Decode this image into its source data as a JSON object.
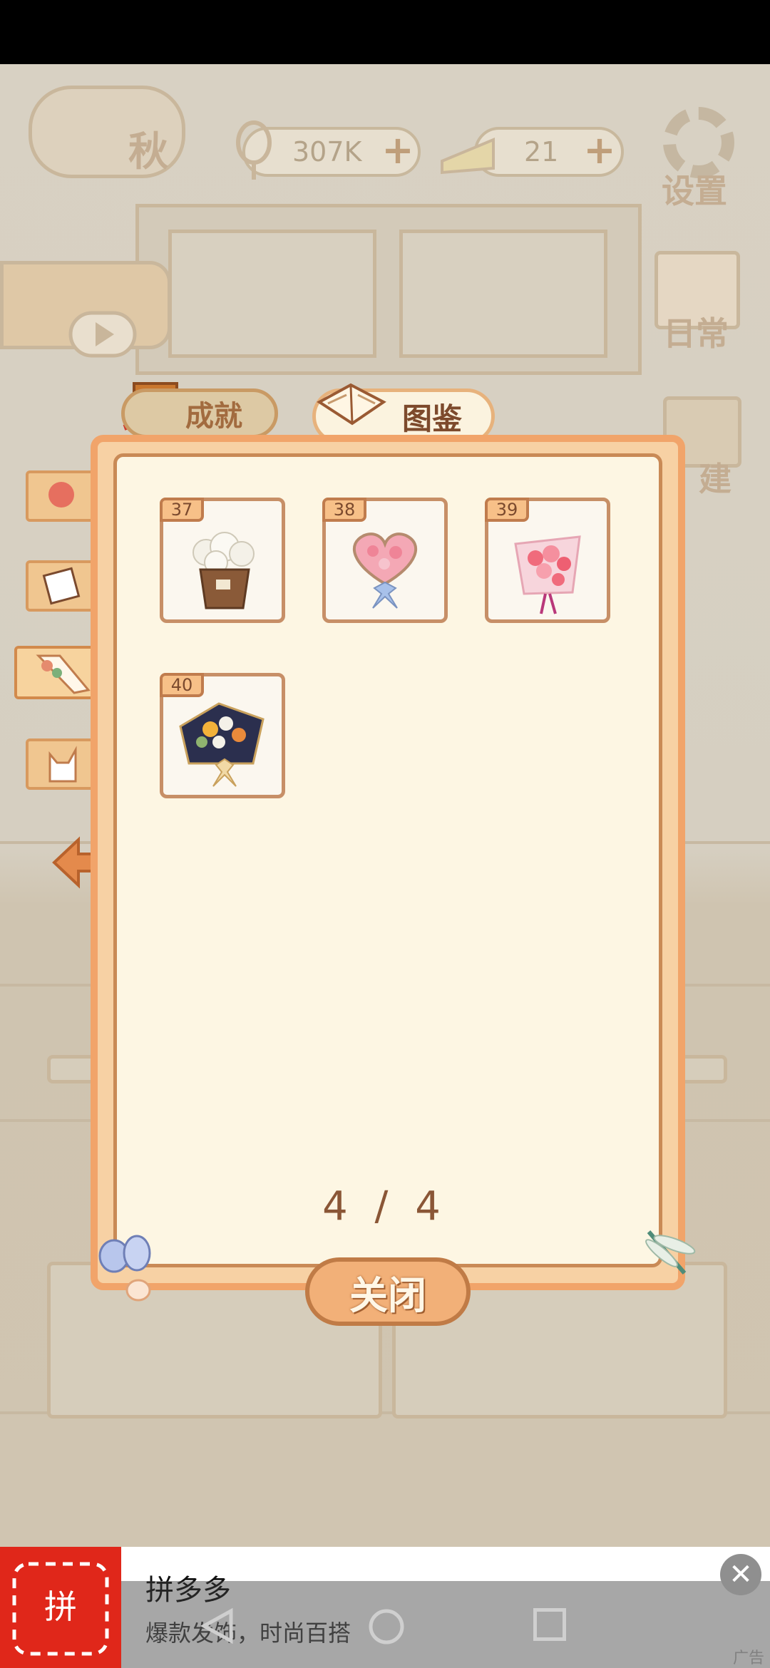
{
  "hud": {
    "player_label": "秋",
    "fish_amount": "307K",
    "cheese_amount": "21",
    "settings_label": "设置",
    "daily_label": "日常",
    "build_label": "建"
  },
  "tabs": {
    "achievement": "成就",
    "collection": "图鉴"
  },
  "collection": {
    "items": [
      {
        "number": "37",
        "name": "white-flower-basket"
      },
      {
        "number": "38",
        "name": "heart-pink-bouquet"
      },
      {
        "number": "39",
        "name": "pink-rose-bouquet"
      },
      {
        "number": "40",
        "name": "navy-wrapped-bouquet"
      }
    ],
    "page": "4 / 4"
  },
  "close_label": "关闭",
  "ad": {
    "title": "拼多多",
    "description": "爆款发饰，时尚百搭",
    "logo_text": "拼",
    "tag": "广告",
    "close_symbol": "✕"
  },
  "colors": {
    "panel_border": "#f1a46a",
    "panel_bg": "#fdf6e3",
    "accent_brown": "#8a5636",
    "ad_red": "#e0271a"
  }
}
